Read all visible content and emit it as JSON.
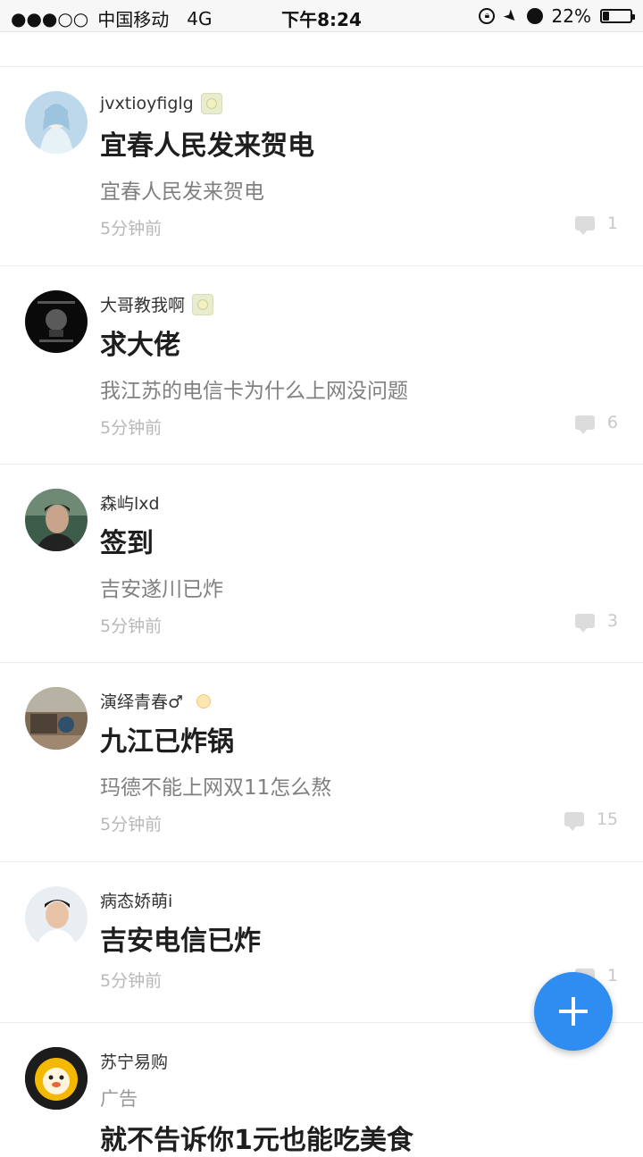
{
  "status_bar": {
    "signal": "●●●○○",
    "carrier": "中国移动",
    "network": "4G",
    "time": "下午8:24",
    "battery_percent": "22%",
    "battery_level": 0.22
  },
  "posts": [
    {
      "username": "jvxtioyfiglg",
      "title": "宜春人民发来贺电",
      "body": "宜春人民发来贺电",
      "time": "5分钟前",
      "comments": "1"
    },
    {
      "username": "大哥教我啊",
      "title": "求大佬",
      "body": "我江苏的电信卡为什么上网没问题",
      "time": "5分钟前",
      "comments": "6"
    },
    {
      "username": "森屿lxd",
      "title": "签到",
      "body": "吉安遂川已炸",
      "time": "5分钟前",
      "comments": "3"
    },
    {
      "username": "演绎青春♂",
      "title": "九江已炸锅",
      "body": "玛德不能上网双11怎么熬",
      "time": "5分钟前",
      "comments": "15"
    },
    {
      "username": "病态娇萌i",
      "title": "吉安电信已炸",
      "body": "",
      "time": "5分钟前",
      "comments": "1"
    },
    {
      "username": "苏宁易购",
      "title": "就不告诉你1元也能吃美食",
      "ad_label": "广告"
    }
  ],
  "fab": {
    "icon": "plus-icon",
    "color": "#2f8cf0"
  }
}
